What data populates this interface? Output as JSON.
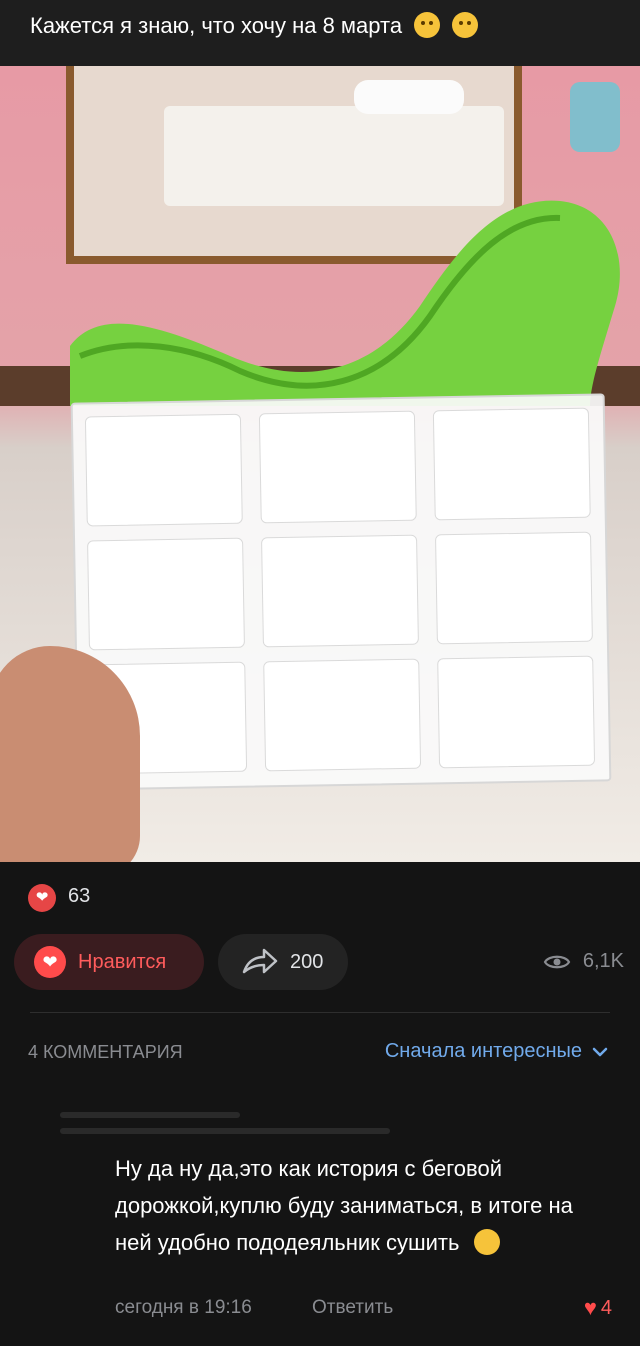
{
  "post": {
    "title": "Кажется я знаю, что хочу на 8 марта"
  },
  "stats": {
    "likes_count": "63",
    "like_label": "Нравится",
    "shares_count": "200",
    "views": "6,1K"
  },
  "comments": {
    "count_label": "4 КОММЕНТАРИЯ",
    "sort_label": "Сначала интересные",
    "items": [
      {
        "text": "Ну да ну да,это как история с беговой дорожкой,куплю буду заниматься, в итоге на ней удобно пододеяльник сушить",
        "time": "сегодня в 19:16",
        "reply_label": "Ответить",
        "likes": "4"
      }
    ]
  },
  "colors": {
    "accent_blue": "#71aaeb",
    "like_red": "#ff4b4b",
    "chair_green": "#6fcf3a"
  }
}
